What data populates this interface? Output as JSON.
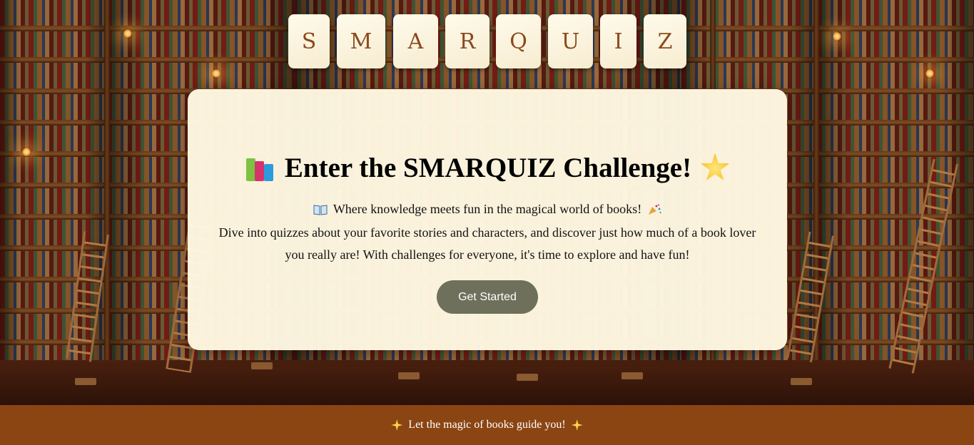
{
  "logo": {
    "letters": [
      "S",
      "M",
      "A",
      "R",
      "Q",
      "U",
      "I",
      "Z"
    ]
  },
  "hero": {
    "title": "Enter the SMARQUIZ Challenge!",
    "title_left_icon": "books-icon",
    "title_right_icon": "star-icon",
    "intro": "Where knowledge meets fun in the magical world of books!",
    "intro_left_icon": "open-book-icon",
    "intro_right_icon": "party-popper-icon",
    "description": "Dive into quizzes about your favorite stories and characters, and discover just how much of a book lover you really are! With challenges for everyone, it's time to explore and have fun!",
    "cta_label": "Get Started"
  },
  "footer": {
    "text": "Let the magic of books guide you!",
    "icon": "sparkles-icon"
  },
  "colors": {
    "tile_text": "#8a4a1e",
    "button_bg": "#6f705c",
    "footer_bg": "#8b4513",
    "card_bg": "#fff8e2"
  }
}
